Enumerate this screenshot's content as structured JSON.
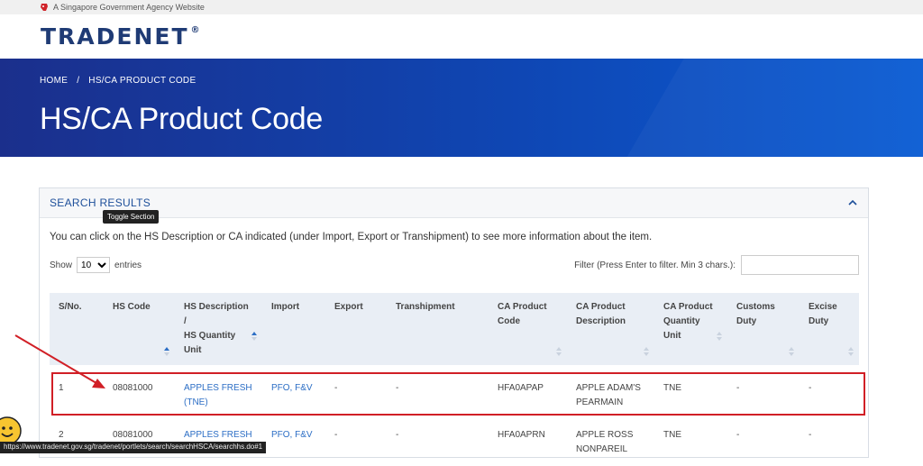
{
  "gov_bar": {
    "text": "A Singapore Government Agency Website"
  },
  "header": {
    "logo": "TRADENET",
    "logo_mark": "®"
  },
  "breadcrumb": {
    "home": "HOME",
    "separator": "/",
    "current": "HS/CA PRODUCT CODE"
  },
  "page_title": "HS/CA Product Code",
  "panel": {
    "title": "SEARCH RESULTS",
    "tooltip": "Toggle Section",
    "intro": "You can click on the HS Description or CA indicated (under Import, Export or Transhipment) to see more information about the item.",
    "show_label": "Show",
    "entries_value": "10",
    "entries_label": "entries",
    "filter_label": "Filter (Press Enter to filter. Min 3 chars.):",
    "filter_value": ""
  },
  "table": {
    "headers": {
      "sno": "S/No.",
      "hs_code": "HS Code",
      "hs_desc_1": "HS Description",
      "hs_desc_2": "/",
      "hs_desc_3": "HS Quantity",
      "hs_desc_4": "Unit",
      "import": "Import",
      "export": "Export",
      "transhipment": "Transhipment",
      "ca_code_1": "CA Product",
      "ca_code_2": "Code",
      "ca_desc_1": "CA Product",
      "ca_desc_2": "Description",
      "ca_qty_1": "CA Product",
      "ca_qty_2": "Quantity",
      "ca_qty_3": "Unit",
      "customs_1": "Customs",
      "customs_2": "Duty",
      "excise_1": "Excise",
      "excise_2": "Duty"
    },
    "rows": [
      {
        "sno": "1",
        "hs_code": "08081000",
        "hs_desc_1": "APPLES FRESH",
        "hs_desc_2": "(TNE)",
        "import": "PFO, F&V",
        "export": "-",
        "transhipment": "-",
        "ca_code": "HFA0APAP",
        "ca_desc_1": "APPLE ADAM'S",
        "ca_desc_2": "PEARMAIN",
        "ca_qty": "TNE",
        "customs": "-",
        "excise": "-"
      },
      {
        "sno": "2",
        "hs_code": "08081000",
        "hs_desc_1": "APPLES FRESH",
        "hs_desc_2": "",
        "import": "PFO, F&V",
        "export": "-",
        "transhipment": "-",
        "ca_code": "HFA0APRN",
        "ca_desc_1": "APPLE ROSS",
        "ca_desc_2": "NONPAREIL",
        "ca_qty": "TNE",
        "customs": "-",
        "excise": "-"
      }
    ]
  },
  "status_url": "https://www.tradenet.gov.sg/tradenet/portlets/search/searchHSCA/searchhs.do#1",
  "colors": {
    "brand": "#1f3b75",
    "hero": "#0f46b3",
    "link": "#2c6ec5",
    "highlight": "#d11f26"
  }
}
